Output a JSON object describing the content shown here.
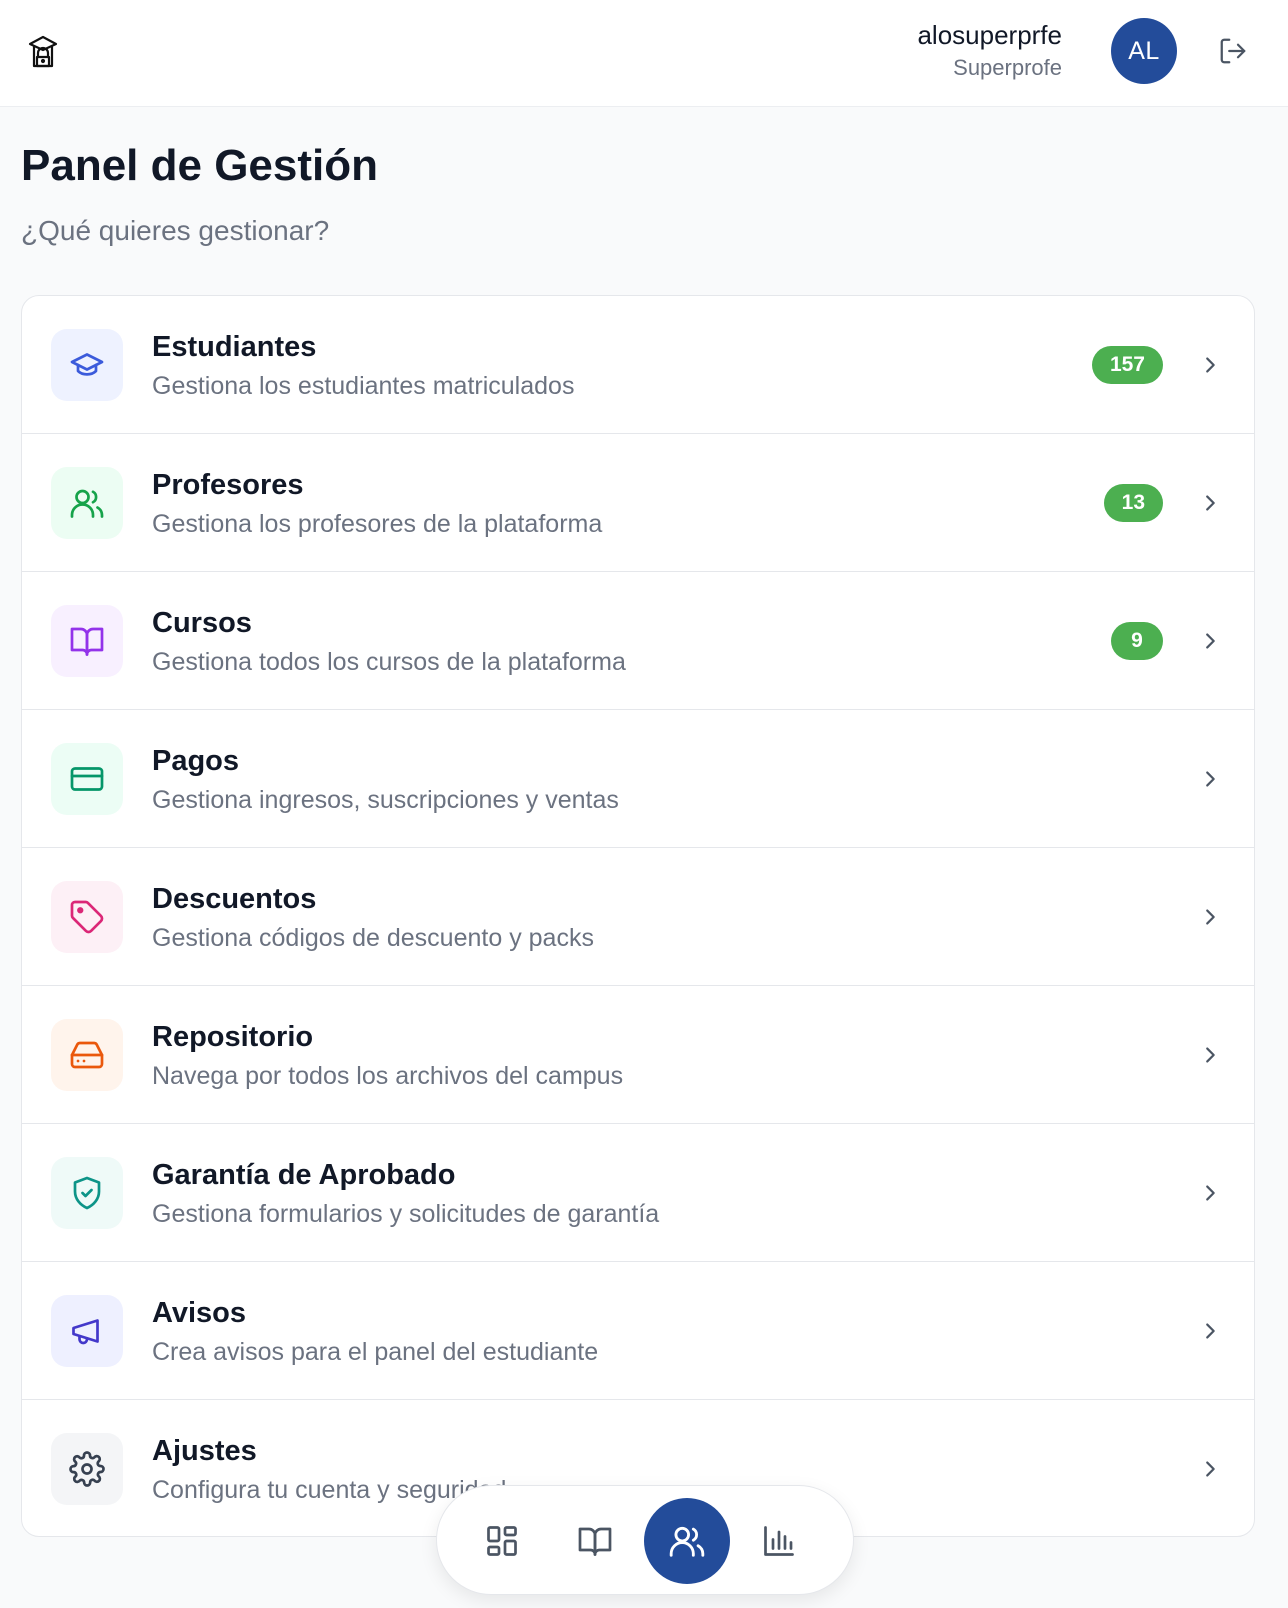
{
  "header": {
    "logo_icon": "school-lock-icon",
    "user_name": "alosuperprfe",
    "user_role": "Superprofe",
    "avatar_initials": "AL",
    "avatar_color": "#234c9a",
    "logout_icon": "logout-icon"
  },
  "page": {
    "title": "Panel de Gestión",
    "subtitle": "¿Qué quieres gestionar?"
  },
  "sections": [
    {
      "title": "Estudiantes",
      "description": "Gestiona los estudiantes matriculados",
      "badge": "157",
      "icon": "graduation-cap-icon",
      "icon_color": "#3b5bdb",
      "icon_bg": "#eef2ff"
    },
    {
      "title": "Profesores",
      "description": "Gestiona los profesores de la plataforma",
      "badge": "13",
      "icon": "users-icon",
      "icon_color": "#16a34a",
      "icon_bg": "#ecfdf3"
    },
    {
      "title": "Cursos",
      "description": "Gestiona todos los cursos de la plataforma",
      "badge": "9",
      "icon": "book-open-icon",
      "icon_color": "#9333ea",
      "icon_bg": "#f8f0ff"
    },
    {
      "title": "Pagos",
      "description": "Gestiona ingresos, suscripciones y ventas",
      "badge": "",
      "icon": "credit-card-icon",
      "icon_color": "#059669",
      "icon_bg": "#ecfdf5"
    },
    {
      "title": "Descuentos",
      "description": "Gestiona códigos de descuento y packs",
      "badge": "",
      "icon": "tag-icon",
      "icon_color": "#db2777",
      "icon_bg": "#fdf0f6"
    },
    {
      "title": "Repositorio",
      "description": "Navega por todos los archivos del campus",
      "badge": "",
      "icon": "hard-drive-icon",
      "icon_color": "#ea580c",
      "icon_bg": "#fff4ec"
    },
    {
      "title": "Garantía de Aprobado",
      "description": "Gestiona formularios y solicitudes de garantía",
      "badge": "",
      "icon": "shield-check-icon",
      "icon_color": "#0d9488",
      "icon_bg": "#effaf8"
    },
    {
      "title": "Avisos",
      "description": "Crea avisos para el panel del estudiante",
      "badge": "",
      "icon": "megaphone-icon",
      "icon_color": "#4338ca",
      "icon_bg": "#eef0ff"
    },
    {
      "title": "Ajustes",
      "description": "Configura tu cuenta y seguridad",
      "badge": "",
      "icon": "gear-icon",
      "icon_color": "#374151",
      "icon_bg": "#f4f5f7"
    }
  ],
  "badge_color": "#4caf50",
  "bottom_nav": [
    {
      "icon": "dashboard-grid-icon",
      "active": false
    },
    {
      "icon": "book-open-icon",
      "active": false
    },
    {
      "icon": "users-icon",
      "active": true
    },
    {
      "icon": "bar-chart-icon",
      "active": false
    }
  ]
}
